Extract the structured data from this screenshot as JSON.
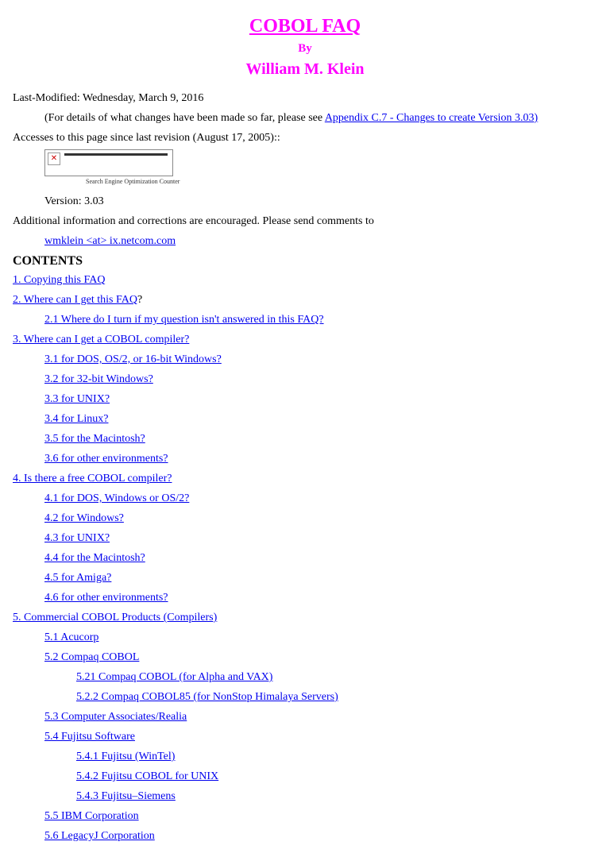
{
  "header": {
    "title": "COBOL FAQ",
    "by": "By",
    "author": "William M. Klein"
  },
  "meta": {
    "last_modified": "Last-Modified: Wednesday, March 9, 2016",
    "details_prefix": "(For details of what changes have been made so far, please see ",
    "details_link": "Appendix C.7 - Changes to create Version 3.03)",
    "accesses": "Accesses to this page since last revision (August 17, 2005)::",
    "counter_caption": "Search Engine Optimization Counter",
    "version": "Version: 3.03",
    "additional_info": "Additional information and corrections are encouraged. Please send comments to",
    "email": "wmklein <at> ix.netcom.com"
  },
  "contents_heading": "CONTENTS",
  "toc": {
    "l1": "1. Copying this FAQ",
    "l2": "2. Where can I get this FAQ",
    "l2_q": "?",
    "l2_1": "2.1 Where do I turn if my question isn't answered in this FAQ?",
    "l3": "3. Where can I get a COBOL compiler?",
    "l3_1": "3.1 for DOS, OS/2, or 16-bit Windows?",
    "l3_2": "3.2 for 32-bit Windows?",
    "l3_3": "3.3 for UNIX?",
    "l3_4": "3.4 for Linux?",
    "l3_5": "3.5 for the Macintosh?",
    "l3_6": "3.6 for other environments?",
    "l4": "4. Is there a free COBOL compiler?",
    "l4_1": "4.1 for DOS, Windows or OS/2?",
    "l4_2": "4.2 for Windows?",
    "l4_3": "4.3 for UNIX?",
    "l4_4": "4.4 for the Macintosh?",
    "l4_5": "4.5 for Amiga?",
    "l4_6": "4.6 for other environments?",
    "l5": "5. Commercial COBOL Products (Compilers)",
    "l5_1": "5.1 Acucorp",
    "l5_2": " 5.2 Compaq COBOL",
    "l5_21": "5.21 Compaq COBOL (for Alpha and VAX)",
    "l5_22": "5.2.2 Compaq COBOL85 (for NonStop Himalaya Servers)",
    "l5_3": " 5.3 Computer Associates/Realia",
    "l5_4": "5.4 Fujitsu Software",
    "l5_41": "5.4.1 Fujitsu (WinTel)",
    "l5_42": "5.4.2 Fujitsu COBOL for UNIX",
    "l5_43": "5.4.3 Fujitsu–Siemens",
    "l5_5": "5.5 IBM Corporation",
    "l5_6": "5.6 LegacyJ Corporation"
  }
}
